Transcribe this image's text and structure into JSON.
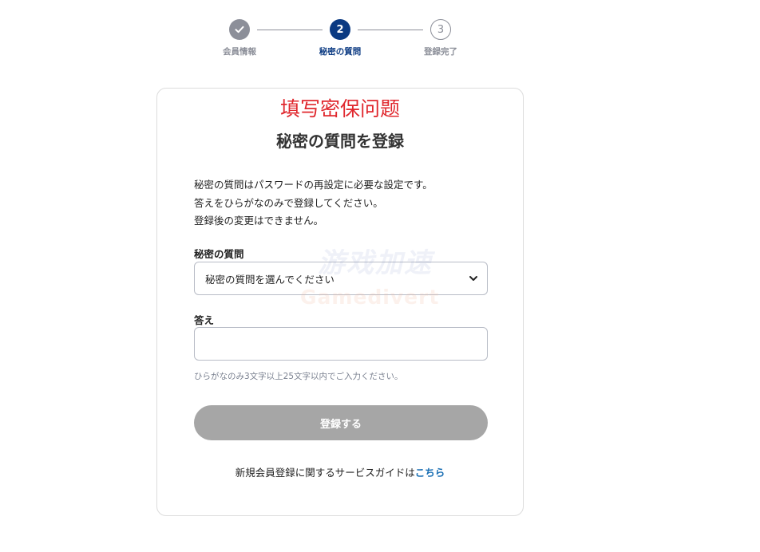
{
  "stepper": {
    "steps": [
      {
        "label": "会員情報",
        "number": "1",
        "state": "complete"
      },
      {
        "label": "秘密の質問",
        "number": "2",
        "state": "current"
      },
      {
        "label": "登録完了",
        "number": "3",
        "state": "upcoming"
      }
    ],
    "complete_icon": "check-icon"
  },
  "annotation": "填写密保问题",
  "form": {
    "title": "秘密の質問を登録",
    "description": [
      "秘密の質問はパスワードの再設定に必要な設定です。",
      "答えをひらがなのみで登録してください。",
      "登録後の変更はできません。"
    ],
    "question_label": "秘密の質問",
    "question_selected": "秘密の質問を選んでください",
    "answer_label": "答え",
    "answer_value": "",
    "answer_hint": "ひらがなのみ3文字以上25文字以内でご入力ください。",
    "submit_label": "登録する",
    "guide_text": "新規会員登録に関するサービスガイドは",
    "guide_link": "こちら"
  },
  "watermark": {
    "top_text": "游戏加速",
    "bottom_text": "Gamedivert"
  },
  "colors": {
    "step_complete": "#8c8f99",
    "step_current": "#0b3a82",
    "annotation": "#e0282e",
    "button_disabled": "#a6a6a6",
    "link": "#1a6fb4"
  }
}
